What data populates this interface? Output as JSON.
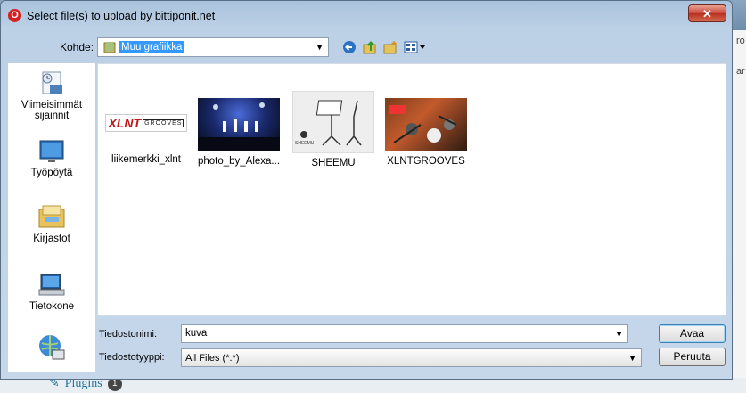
{
  "dialog": {
    "title": "Select file(s) to upload by bittiponit.net",
    "close_label": "✕"
  },
  "location": {
    "label": "Kohde:",
    "value": "Muu grafiikka"
  },
  "sidebar": {
    "items": [
      {
        "label": "Viimeisimmät sijainnit",
        "icon": "recent-places-icon"
      },
      {
        "label": "Työpöytä",
        "icon": "desktop-icon"
      },
      {
        "label": "Kirjastot",
        "icon": "libraries-icon"
      },
      {
        "label": "Tietokone",
        "icon": "computer-icon"
      },
      {
        "label": "",
        "icon": "network-icon"
      }
    ]
  },
  "files": [
    {
      "name": "liikemerkki_xlnt",
      "logo_text": "XLNT",
      "logo_sub": "GROOVES"
    },
    {
      "name": "photo_by_Alexa..."
    },
    {
      "name": "SHEEMU",
      "logo_text": "SHEEMU"
    },
    {
      "name": "XLNTGROOVES"
    }
  ],
  "filename": {
    "label": "Tiedostonimi:",
    "value": "kuva"
  },
  "filetype": {
    "label": "Tiedostotyyppi:",
    "value": "All Files (*.*)"
  },
  "buttons": {
    "open": "Avaa",
    "cancel": "Peruuta"
  },
  "background": {
    "plugins_label": "Plugins",
    "plugins_count": "1",
    "side_text_1": "ro",
    "side_text_2": "ar"
  }
}
